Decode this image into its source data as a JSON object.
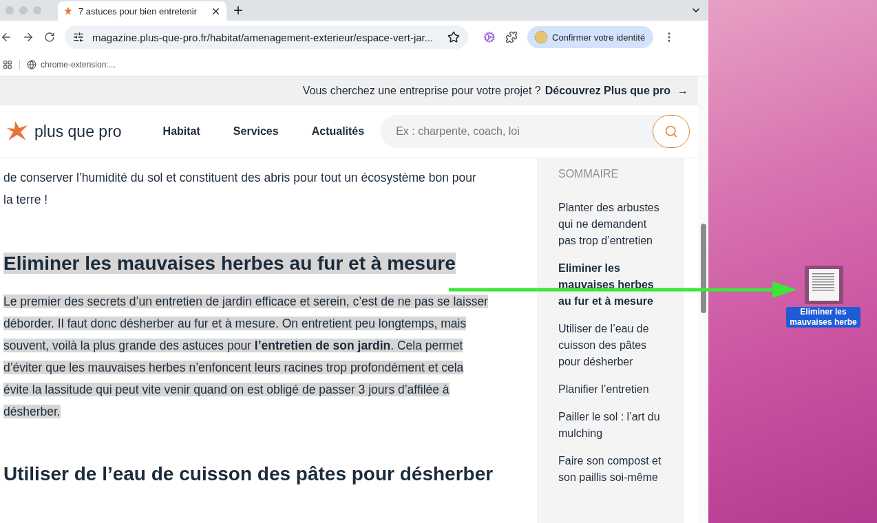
{
  "browser": {
    "tab": {
      "title": "7 astuces pour bien entretenir",
      "selected": true
    },
    "url": "magazine.plus-que-pro.fr/habitat/amenagement-exterieur/espace-vert-jar...",
    "profile_button": "Confirmer votre identité",
    "bookmark": "chrome-extension:..."
  },
  "banner": {
    "text": "Vous cherchez une entreprise pour votre projet ?",
    "link": "Découvrez Plus que pro",
    "arrow": "→"
  },
  "header": {
    "logo": "plus que pro",
    "nav": [
      "Habitat",
      "Services",
      "Actualités"
    ],
    "search": {
      "placeholder": "Ex : charpente, coach, loi"
    }
  },
  "article": [
    {
      "kind": "paragraph",
      "text": "de conserver l’humidité du sol et constituent des abris pour tout un écosystème bon pour la terre !",
      "selected": false
    },
    {
      "kind": "heading",
      "text": "Eliminer les mauvaises herbes au fur et à mesure",
      "selected": true
    },
    {
      "kind": "paragraph",
      "text": "Le premier des secrets d’un entretien de jardin efficace et serein, c’est de ne pas se laisser déborder. Il faut donc désherber au fur et à mesure. On entretient peu longtemps, mais souvent, voilà la plus grande des astuces pour **l’entretien de son jardin**. Cela permet d’éviter que les mauvaises herbes n’enfoncent leurs racines trop profondément et cela évite la lassitude qui peut vite venir quand on est obligé de passer 3 jours d’affilée à désherber.",
      "selected": true
    },
    {
      "kind": "heading",
      "text": "Utiliser de l’eau de cuisson des pâtes pour désherber",
      "selected": false
    }
  ],
  "summary": {
    "title": "SOMMAIRE",
    "items": [
      {
        "label": "Planter des arbustes qui ne demandent pas trop d’entretien",
        "selected": false
      },
      {
        "label": "Eliminer les mauvaises herbes au fur et à mesure",
        "selected": true
      },
      {
        "label": "Utiliser de l’eau de cuisson des pâtes pour désherber",
        "selected": false
      },
      {
        "label": "Planifier l’entretien",
        "selected": false
      },
      {
        "label": "Pailler le sol : l’art du mulching",
        "selected": false
      },
      {
        "label": "Faire son compost et son paillis soi-même",
        "selected": false
      }
    ]
  },
  "desktop": {
    "file": {
      "label": "Eliminer les mauvaises herbe",
      "selected": true
    }
  }
}
